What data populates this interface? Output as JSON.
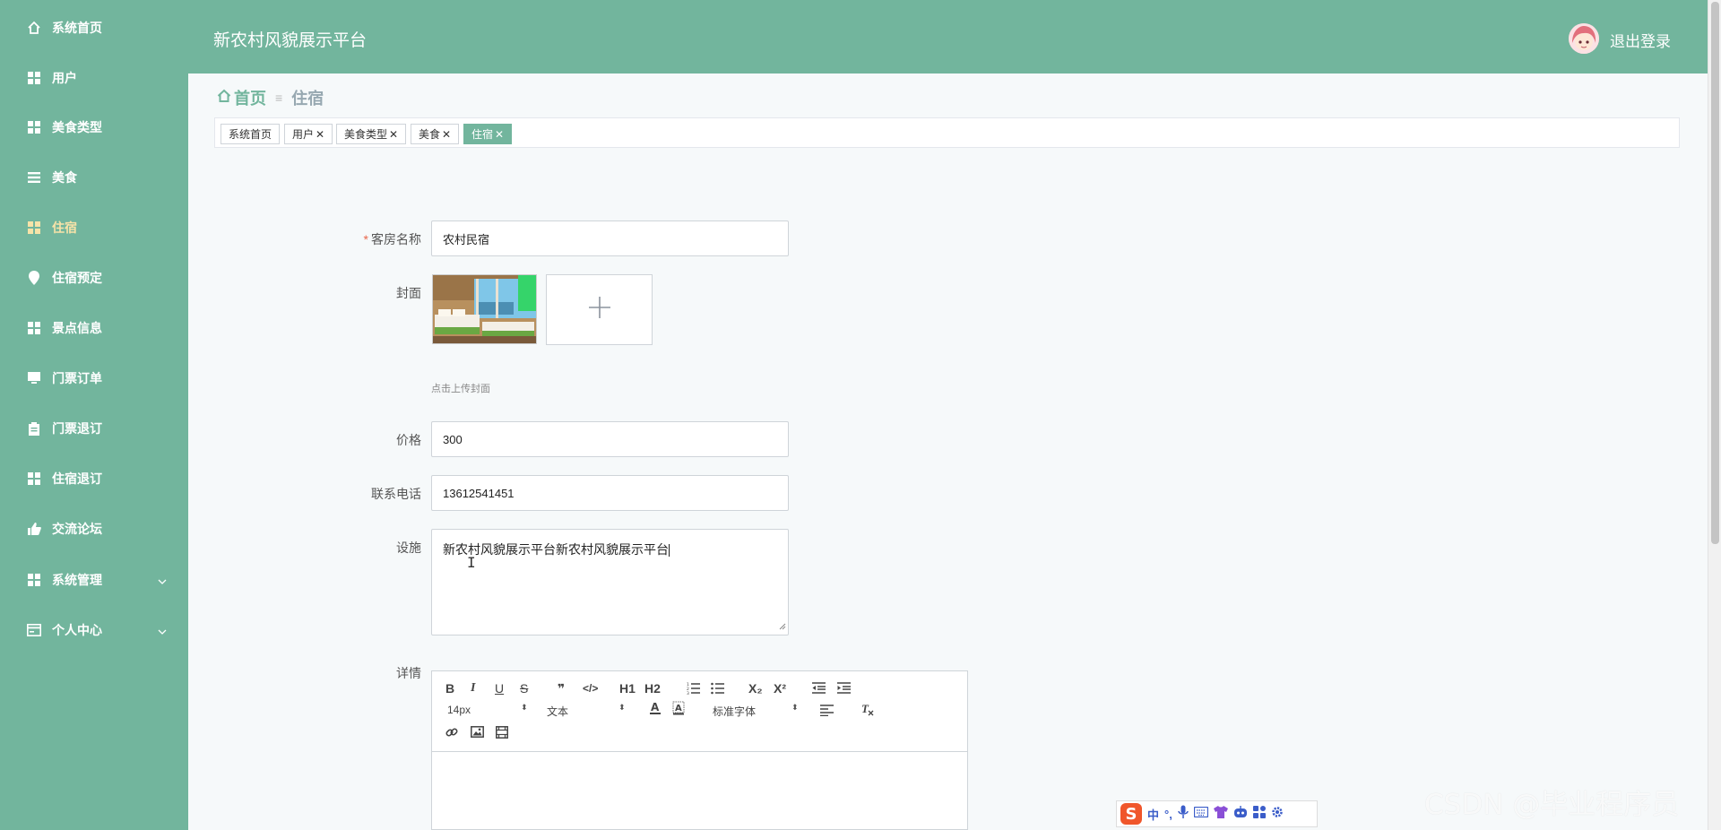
{
  "sidebar": {
    "items": [
      {
        "label": "系统首页",
        "icon": "home-icon"
      },
      {
        "label": "用户",
        "icon": "grid-icon"
      },
      {
        "label": "美食类型",
        "icon": "grid-icon"
      },
      {
        "label": "美食",
        "icon": "list-icon"
      },
      {
        "label": "住宿",
        "icon": "grid-icon"
      },
      {
        "label": "住宿预定",
        "icon": "pin-icon"
      },
      {
        "label": "景点信息",
        "icon": "grid-icon"
      },
      {
        "label": "门票订单",
        "icon": "monitor-icon"
      },
      {
        "label": "门票退订",
        "icon": "clipboard-icon"
      },
      {
        "label": "住宿退订",
        "icon": "grid-icon"
      },
      {
        "label": "交流论坛",
        "icon": "thumb-icon"
      },
      {
        "label": "系统管理",
        "icon": "grid-icon"
      },
      {
        "label": "个人中心",
        "icon": "card-icon"
      }
    ],
    "active_label": "住宿"
  },
  "header": {
    "title": "新农村风貌展示平台",
    "logout_label": "退出登录"
  },
  "breadcrumb": {
    "home": "首页",
    "current": "住宿"
  },
  "tags": [
    {
      "label": "系统首页",
      "closable": false
    },
    {
      "label": "用户",
      "closable": true
    },
    {
      "label": "美食类型",
      "closable": true
    },
    {
      "label": "美食",
      "closable": true
    },
    {
      "label": "住宿",
      "closable": true
    }
  ],
  "tag_close_glyph": "✕",
  "form": {
    "room_name": {
      "label": "客房名称",
      "value": "农村民宿",
      "required_mark": "*"
    },
    "cover": {
      "label": "封面",
      "hint": "点击上传封面"
    },
    "price": {
      "label": "价格",
      "value": "300"
    },
    "phone": {
      "label": "联系电话",
      "value": "13612541451"
    },
    "facilities": {
      "label": "设施",
      "value": "新农村风貌展示平台新农村风貌展示平台"
    },
    "details": {
      "label": "详情"
    }
  },
  "editor": {
    "buttons": [
      "B",
      "I",
      "U",
      "S",
      "❞",
      "</>",
      "H1",
      "H2",
      "ordered-list",
      "bullet-list",
      "X₂",
      "X²",
      "outdent",
      "indent"
    ],
    "size_select": "14px",
    "header_select": "文本",
    "font_select": "标准字体"
  },
  "ime": {
    "items": [
      "中",
      "°,",
      "mic",
      "keyboard",
      "shirt",
      "robot",
      "apps",
      "gear"
    ]
  },
  "watermark": "CSDN @毕业程序员",
  "colors": {
    "primary": "#72b59d",
    "active_text": "#f7e3a8",
    "required": "#e8664b"
  }
}
